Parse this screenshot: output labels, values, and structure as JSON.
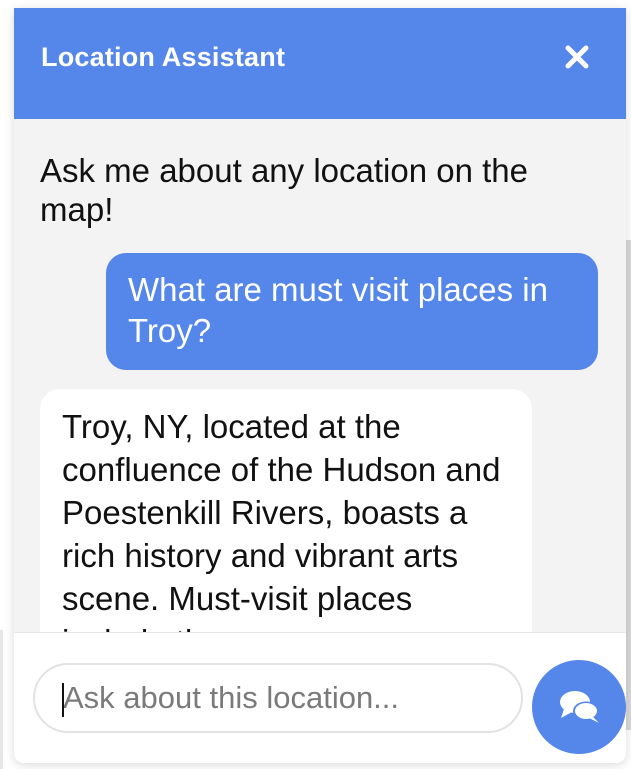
{
  "header": {
    "title": "Location Assistant",
    "close_icon": "close-icon"
  },
  "messages": {
    "intro": "Ask me about any location on the map!",
    "user": "What are must visit places in Troy?",
    "assistant": "Troy, NY, located at the confluence of the Hudson and Poestenkill Rivers, boasts a rich history and vibrant arts scene. Must-visit places include the"
  },
  "input": {
    "placeholder": "Ask about this location...",
    "value": ""
  },
  "send_button": {
    "icon": "chat-bubbles-icon"
  },
  "colors": {
    "accent": "#5586ea",
    "panel_background": "#f3f3f3",
    "bubble_background": "#ffffff"
  }
}
